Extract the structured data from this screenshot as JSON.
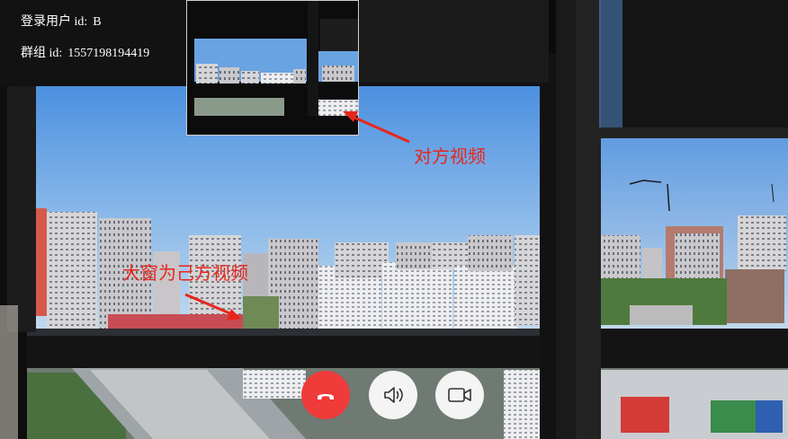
{
  "session": {
    "user_label": "登录用户 id:",
    "user_id": "B",
    "group_label": "群组 id:",
    "group_id": "1557198194419"
  },
  "annotations": {
    "remote_video": "对方视频",
    "big_window": "大窗为己方视频"
  },
  "controls": {
    "hangup_icon": "phone-hangup-icon",
    "speaker_icon": "speaker-icon",
    "camera_icon": "video-camera-icon"
  },
  "colors": {
    "hangup": "#ef3b3a",
    "control_bg": "#f4f4f4",
    "annotation": "#e8261c"
  }
}
